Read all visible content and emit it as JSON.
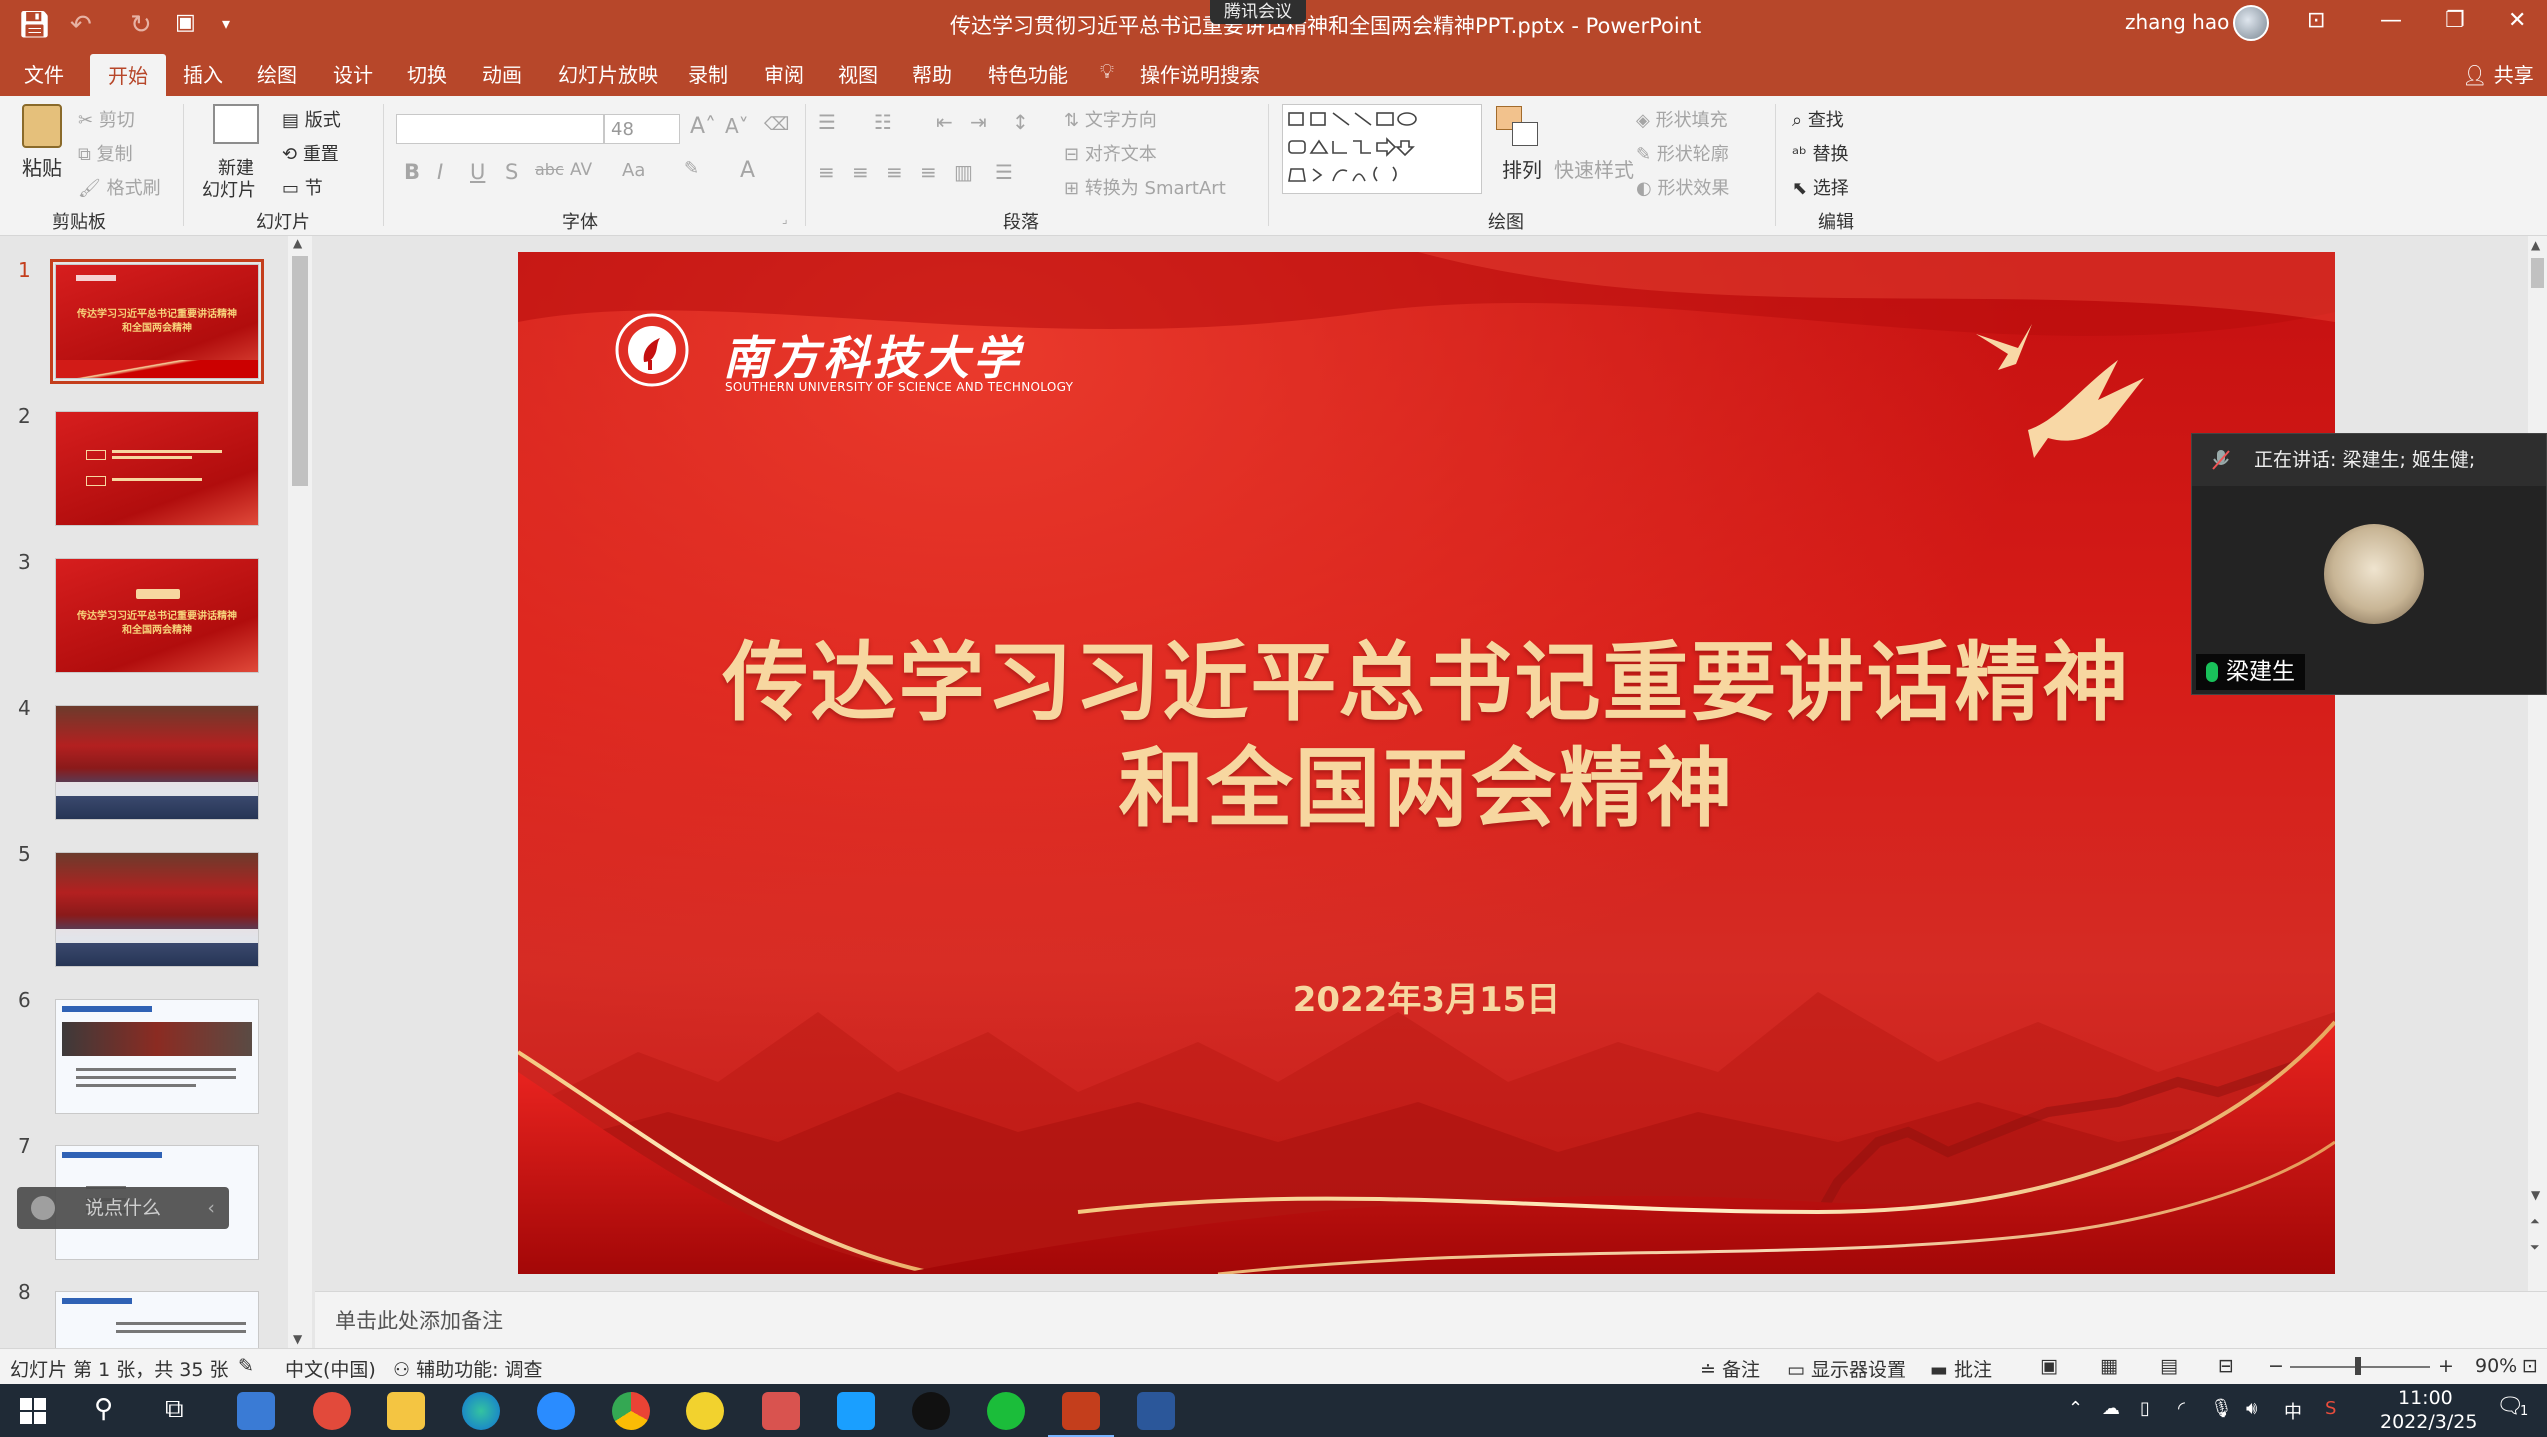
{
  "window": {
    "doc_title": "传达学习贯彻习近平总书记重要讲话精神和全国两会精神PPT.pptx  -  PowerPoint",
    "app_name": "PowerPoint",
    "user_name": "zhang hao",
    "tencent_meeting": "腾讯会议"
  },
  "tabs": [
    "文件",
    "开始",
    "插入",
    "绘图",
    "设计",
    "切换",
    "动画",
    "幻灯片放映",
    "录制",
    "审阅",
    "视图",
    "帮助",
    "特色功能"
  ],
  "active_tab": "开始",
  "tell_me": "操作说明搜索",
  "share": "共享",
  "ribbon": {
    "clipboard": {
      "paste": "粘贴",
      "cut": "剪切",
      "copy": "复制",
      "format_painter": "格式刷",
      "label": "剪贴板"
    },
    "slides": {
      "new_slide_1": "新建",
      "new_slide_2": "幻灯片",
      "layout": "版式",
      "reset": "重置",
      "section": "节",
      "label": "幻灯片"
    },
    "font": {
      "size": "48",
      "label": "字体",
      "bold": "B",
      "italic": "I",
      "underline": "U",
      "shadow": "S",
      "strike": "abc",
      "spacing": "AV",
      "case": "Aa",
      "color": "A"
    },
    "paragraph": {
      "text_direction": "文字方向",
      "align_text": "对齐文本",
      "smartart": "转换为 SmartArt",
      "label": "段落"
    },
    "drawing": {
      "arrange": "排列",
      "quick_styles": "快速样式",
      "shape_fill": "形状填充",
      "shape_outline": "形状轮廓",
      "shape_effects": "形状效果",
      "label": "绘图"
    },
    "editing": {
      "find": "查找",
      "replace": "替换",
      "select": "选择",
      "label": "编辑"
    }
  },
  "thumbnails": [
    {
      "num": "1",
      "kind": "title"
    },
    {
      "num": "2",
      "kind": "agenda"
    },
    {
      "num": "3",
      "kind": "section"
    },
    {
      "num": "4",
      "kind": "hall"
    },
    {
      "num": "5",
      "kind": "hall"
    },
    {
      "num": "6",
      "kind": "content"
    },
    {
      "num": "7",
      "kind": "content"
    },
    {
      "num": "8",
      "kind": "content"
    }
  ],
  "chat_pill": "说点什么",
  "slide": {
    "univ_cn": "南方科技大学",
    "univ_en": "SOUTHERN UNIVERSITY OF SCIENCE AND TECHNOLOGY",
    "title_line1": "传达学习习近平总书记重要讲话精神",
    "title_line2": "和全国两会精神",
    "date": "2022年3月15日"
  },
  "notes_placeholder": "单击此处添加备注",
  "meeting": {
    "speaking": "正在讲话: 梁建生; 姬生健;",
    "participant": "梁建生"
  },
  "status": {
    "slide_info": "幻灯片 第 1 张，共 35 张",
    "language": "中文(中国)",
    "accessibility": "辅助功能: 调查",
    "notes": "备注",
    "display_settings": "显示器设置",
    "comments": "批注",
    "zoom": "90%"
  },
  "taskbar": {
    "ime": "中",
    "time": "11:00",
    "date": "2022/3/25",
    "notif_count": "1"
  },
  "colors": {
    "accent": "#b7472a",
    "slide_red": "#d21b17",
    "slide_gold": "#f7d7a0"
  }
}
